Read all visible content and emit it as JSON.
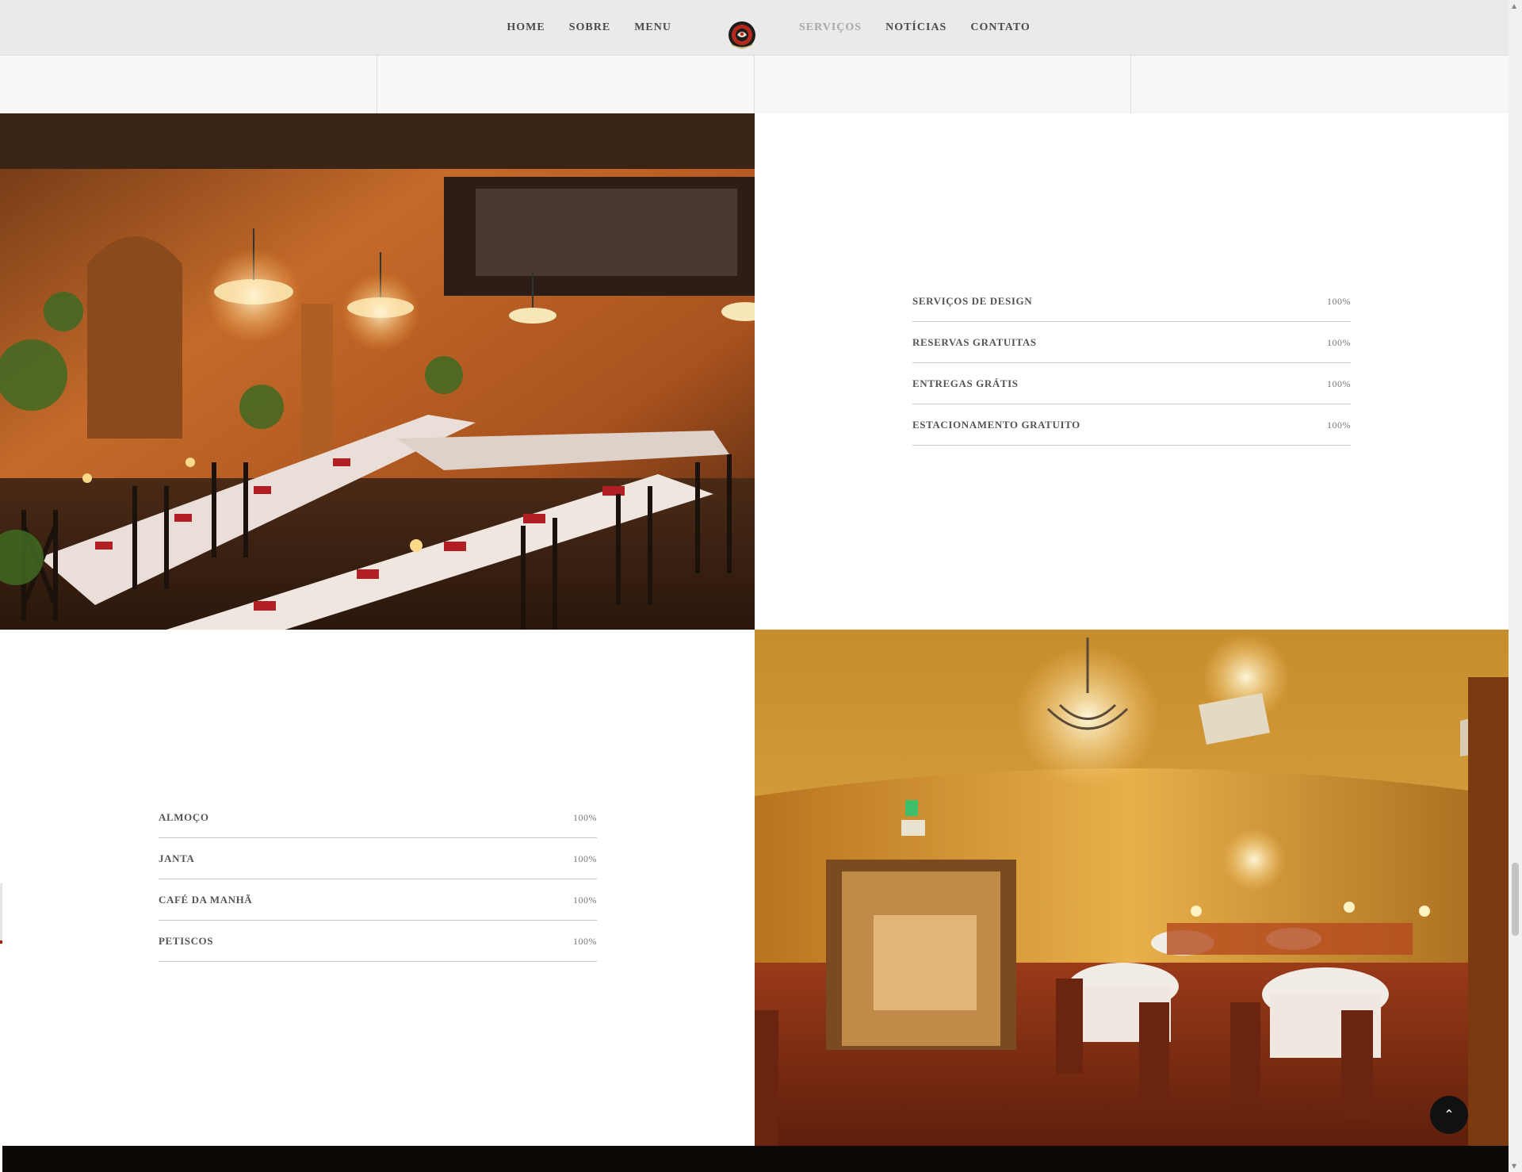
{
  "nav": {
    "left_items": [
      "HOME",
      "SOBRE",
      "MENU"
    ],
    "right_items": [
      "SERVIÇOS",
      "NOTÍCIAS",
      "CONTATO"
    ],
    "active_item": "SERVIÇOS"
  },
  "services_list_1": [
    {
      "label": "SERVIÇOS DE DESIGN",
      "percent": "100%"
    },
    {
      "label": "RESERVAS GRATUITAS",
      "percent": "100%"
    },
    {
      "label": "ENTREGAS GRÁTIS",
      "percent": "100%"
    },
    {
      "label": "ESTACIONAMENTO GRATUITO",
      "percent": "100%"
    }
  ],
  "services_list_2": [
    {
      "label": "ALMOÇO",
      "percent": "100%"
    },
    {
      "label": "JANTA",
      "percent": "100%"
    },
    {
      "label": "CAFÉ DA MANHÃ",
      "percent": "100%"
    },
    {
      "label": "PETISCOS",
      "percent": "100%"
    }
  ],
  "progress": {
    "list_1": [
      1.0,
      1.0,
      1.0,
      1.0
    ],
    "list_2": [
      1.0,
      1.0,
      1.0,
      1.0
    ]
  },
  "icons": {
    "scroll_top": "chevron-up-icon",
    "logo": "restaurant-logo"
  },
  "colors": {
    "header_bg": "#eaeaea",
    "nav_text": "#4b4b4b",
    "nav_active": "#a8a8a8",
    "footer_bg": "#0d0906",
    "accent_red": "#a82010"
  }
}
